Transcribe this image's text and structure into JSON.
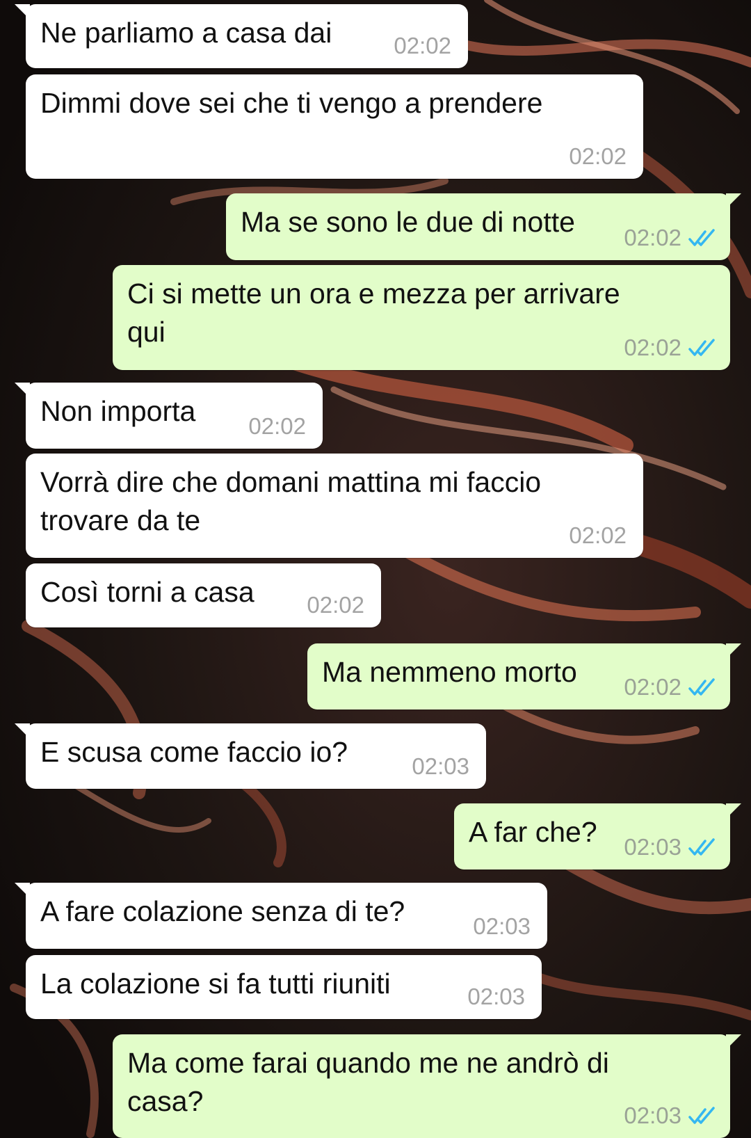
{
  "messages": [
    {
      "dir": "in",
      "text": "Ne parliamo a casa dai",
      "time": "02:02"
    },
    {
      "dir": "in",
      "text": "Dimmi dove sei che ti vengo a prendere",
      "time": "02:02"
    },
    {
      "dir": "out",
      "text": "Ma se sono le due di notte",
      "time": "02:02",
      "status": "read-double-check-icon"
    },
    {
      "dir": "out",
      "text": "Ci si mette un ora e mezza per arrivare\nqui",
      "time": "02:02",
      "status": "read-double-check-icon"
    },
    {
      "dir": "in",
      "text": "Non importa",
      "time": "02:02"
    },
    {
      "dir": "in",
      "text": "Vorrà dire che domani mattina mi faccio\ntrovare da te",
      "time": "02:02"
    },
    {
      "dir": "in",
      "text": "Così torni a casa",
      "time": "02:02"
    },
    {
      "dir": "out",
      "text": "Ma nemmeno morto",
      "time": "02:02",
      "status": "read-double-check-icon"
    },
    {
      "dir": "in",
      "text": "E scusa come faccio io?",
      "time": "02:03"
    },
    {
      "dir": "out",
      "text": "A far che?",
      "time": "02:03",
      "status": "read-double-check-icon"
    },
    {
      "dir": "in",
      "text": "A fare colazione senza di te?",
      "time": "02:03"
    },
    {
      "dir": "in",
      "text": "La colazione si fa tutti riuniti",
      "time": "02:03"
    },
    {
      "dir": "out",
      "text": "Ma come farai quando me ne andrò di\ncasa?",
      "time": "02:03",
      "status": "read-double-check-icon"
    }
  ],
  "colors": {
    "incoming_bubble": "#ffffff",
    "outgoing_bubble": "#e2fdc9",
    "read_ticks": "#34b7f1",
    "timestamp": "#a3a3a3"
  }
}
